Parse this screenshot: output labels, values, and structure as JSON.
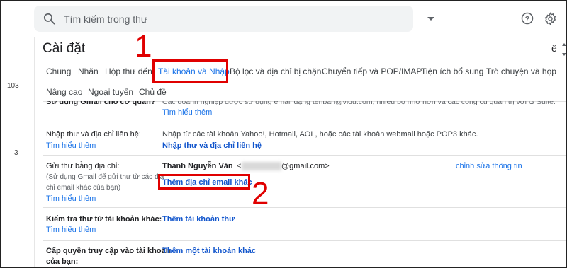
{
  "search": {
    "placeholder": "Tìm kiếm trong thư"
  },
  "header": {
    "title": "Cài đặt",
    "lang_fragment": "ê"
  },
  "sidebar": {
    "counts": [
      "103",
      "3"
    ]
  },
  "tabs": [
    {
      "label": "Chung",
      "active": false
    },
    {
      "label": "Nhãn",
      "active": false
    },
    {
      "label": "Hộp thư đến",
      "active": false
    },
    {
      "label": "Tài khoản và Nhập",
      "active": true
    },
    {
      "label": "Bộ lọc và địa chỉ bị chặn",
      "active": false
    },
    {
      "label": "Chuyển tiếp và POP/IMAP",
      "active": false
    },
    {
      "label": "Tiện ích bổ sung",
      "active": false
    },
    {
      "label": "Trò chuyện và họp",
      "active": false
    },
    {
      "label": "Nâng cao",
      "active": false
    },
    {
      "label": "Ngoại tuyến",
      "active": false
    },
    {
      "label": "Chủ đề",
      "active": false
    }
  ],
  "rows": {
    "gsuite": {
      "label": "Sử dụng Gmail cho cơ quan?",
      "text": "Các doanh nghiệp được sử dụng email dạng tenban@vidu.com, nhiều bộ nhớ hơn và các công cụ quản trị với G Suite.",
      "link": "Tìm hiểu thêm"
    },
    "import": {
      "label": "Nhập thư và địa chỉ liên hệ:",
      "learn": "Tìm hiểu thêm",
      "text": "Nhập từ các tài khoản Yahoo!, Hotmail, AOL, hoặc các tài khoản webmail hoặc POP3 khác.",
      "action": "Nhập thư và địa chỉ liên hệ"
    },
    "sendas": {
      "label": "Gửi thư bằng địa chỉ:",
      "sub1": "(Sử dụng Gmail để gửi thư từ các địa",
      "sub2": "chỉ email khác của bạn)",
      "learn": "Tìm hiểu thêm",
      "name": "Thanh Nguyễn Văn",
      "email_hidden": "<",
      "email_tail": "@gmail.com>",
      "edit": "chỉnh sửa thông tin",
      "add": "Thêm địa chỉ email khác"
    },
    "check": {
      "label": "Kiểm tra thư từ tài khoản khác:",
      "learn": "Tìm hiểu thêm",
      "action": "Thêm tài khoản thư"
    },
    "grant": {
      "label1": "Cấp quyền truy cập vào tài khoản",
      "label2": "của bạn:",
      "action": "Thêm một tài khoản khác"
    }
  },
  "annotations": {
    "step1": "1",
    "step2": "2"
  },
  "colors": {
    "accent": "#1a73e8",
    "annotation": "#e00000"
  }
}
